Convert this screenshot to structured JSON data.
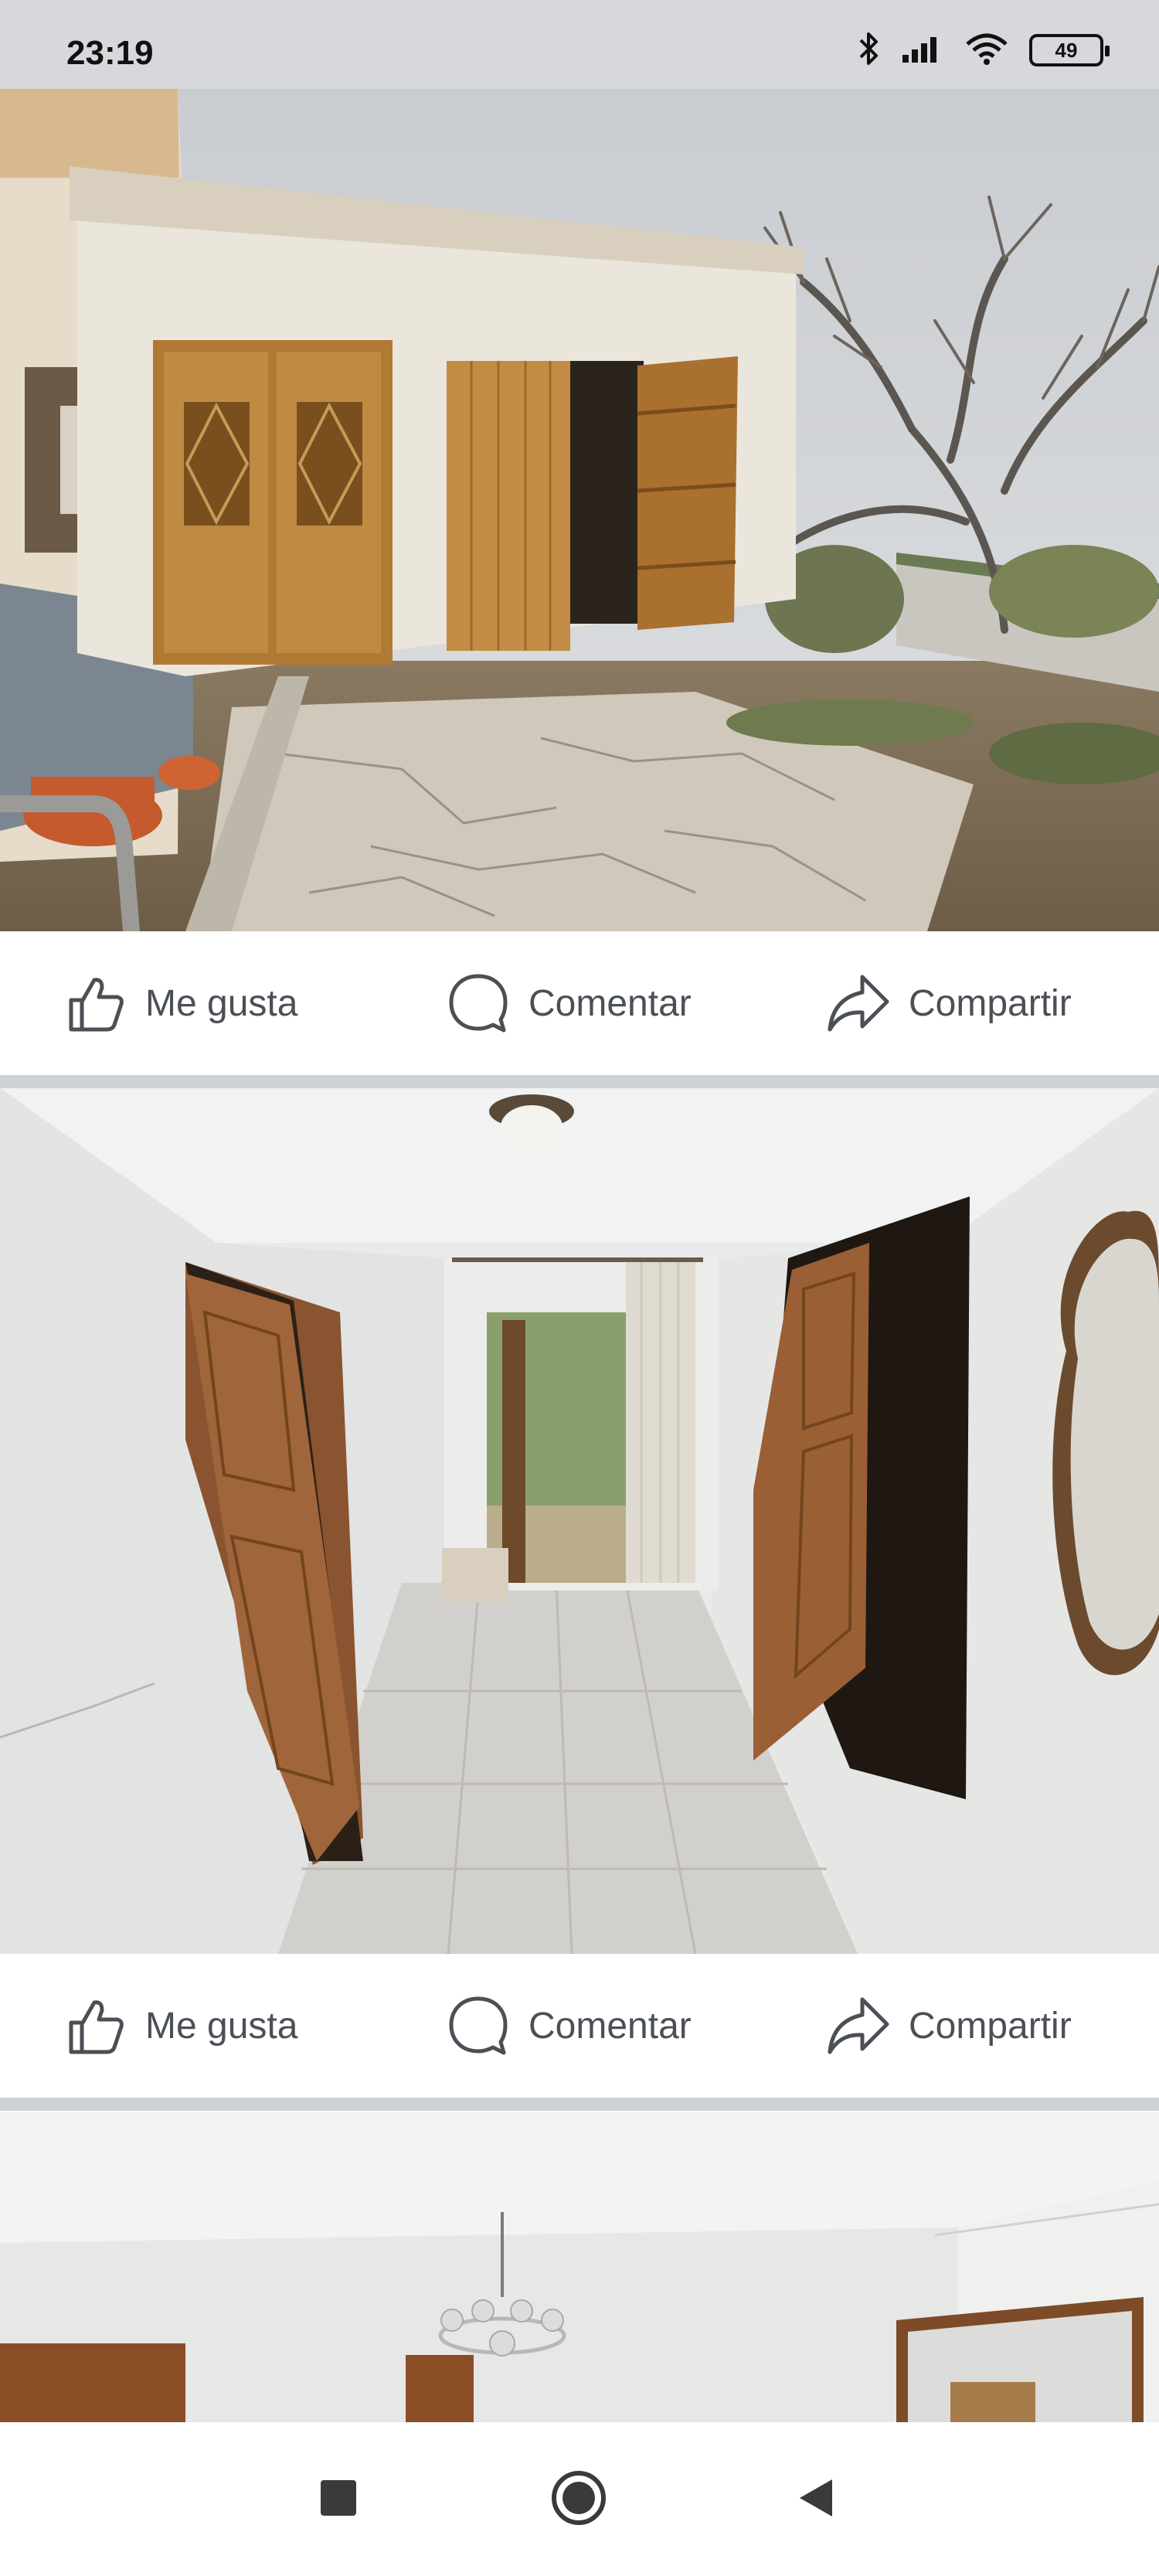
{
  "status_bar": {
    "time": "23:19",
    "battery_level": "49",
    "icons": [
      "bluetooth-icon",
      "signal-icon",
      "wifi-icon",
      "battery-icon"
    ]
  },
  "actions": {
    "like_label": "Me gusta",
    "comment_label": "Comentar",
    "share_label": "Compartir"
  },
  "photos": [
    {
      "subject": "exterior patio with wooden doors and bare fig tree"
    },
    {
      "subject": "white hallway with wooden doors and ornate mirror"
    },
    {
      "subject": "room with chandelier and wooden doors"
    }
  ],
  "nav_bar": {
    "icons": [
      "recent-apps-icon",
      "home-icon",
      "back-icon"
    ]
  },
  "colors": {
    "status_bar_bg": "#d6d8dc",
    "separator": "#cdd0d5",
    "action_text": "#4b4f56"
  }
}
